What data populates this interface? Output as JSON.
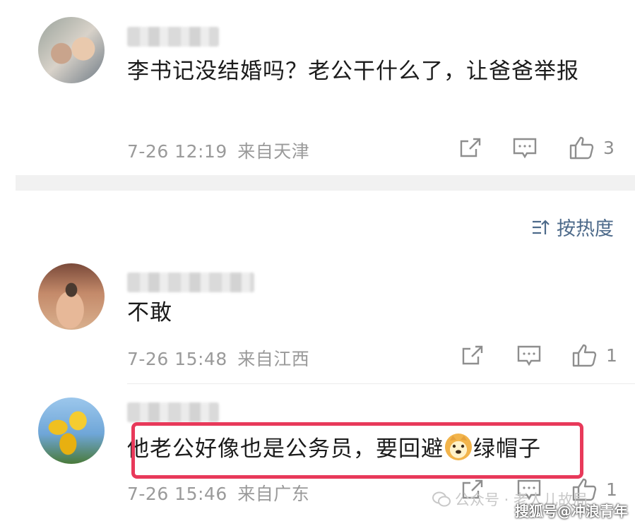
{
  "comments": [
    {
      "text": "李书记没结婚吗？老公干什么了，让爸爸举报",
      "time": "7-26 12:19",
      "location": "来自天津",
      "likes": "3"
    },
    {
      "text": "不敢",
      "time": "7-26 15:48",
      "location": "来自江西",
      "likes": "1"
    },
    {
      "text_before": "他老公好像也是公务员，要回避",
      "text_after": "绿帽子",
      "time": "7-26 15:46",
      "location": "来自广东",
      "likes": "1"
    }
  ],
  "sort": {
    "label": "按热度"
  },
  "watermark": {
    "label": "公众号 · 老人儿故局"
  },
  "brand": {
    "label": "搜狐号@冲浪青年"
  },
  "colors": {
    "highlight": "#e8395a",
    "sort_text": "#4d6a8a",
    "meta_text": "#9a9a9a"
  }
}
